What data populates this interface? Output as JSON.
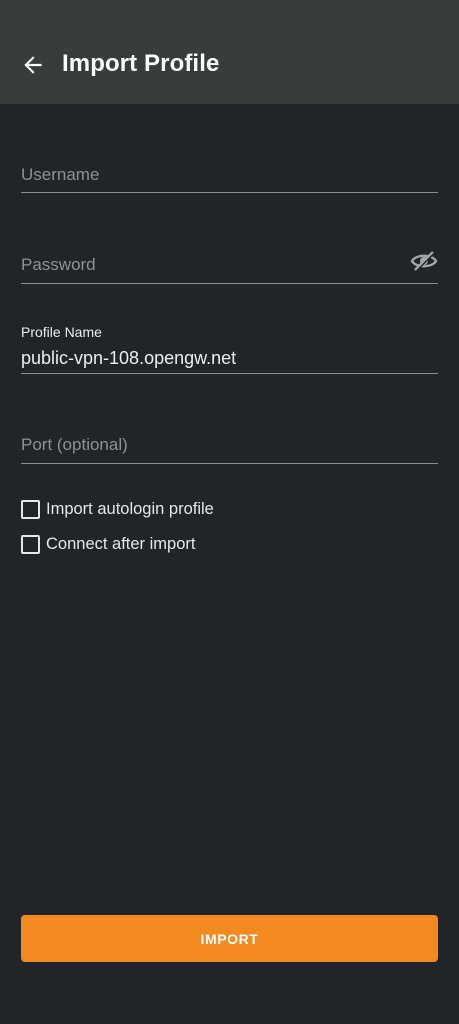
{
  "app_bar": {
    "title": "Import Profile",
    "back_icon": "arrow-left-icon",
    "background": "#373c3d"
  },
  "form": {
    "username": {
      "placeholder": "Username",
      "value": ""
    },
    "password": {
      "placeholder": "Password",
      "value": "",
      "toggle_icon": "eye-off-icon"
    },
    "profile_name": {
      "label": "Profile Name",
      "value": "public-vpn-108.opengw.net"
    },
    "port": {
      "placeholder": "Port (optional)",
      "value": ""
    }
  },
  "options": {
    "autologin": {
      "label": "Import autologin profile",
      "checked": false
    },
    "connect_after": {
      "label": "Connect after import",
      "checked": false
    }
  },
  "actions": {
    "import_label": "IMPORT",
    "accent": "#f28a20"
  },
  "colors": {
    "background": "#212429",
    "text": "#eceded",
    "hint": "#8e9196"
  }
}
